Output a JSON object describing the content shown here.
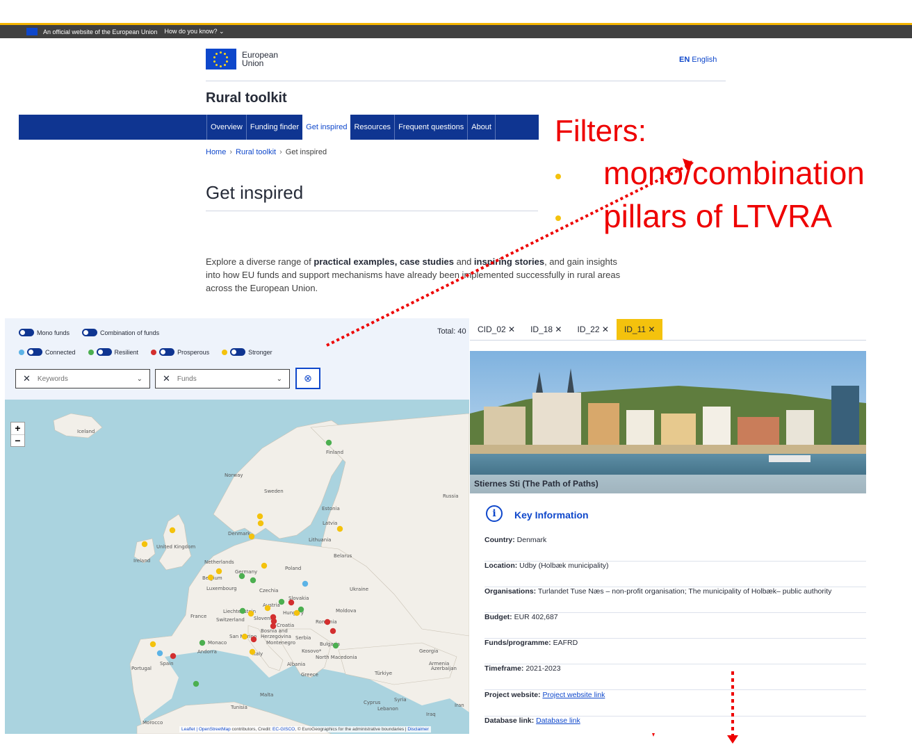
{
  "official_banner": {
    "text": "An official website of the European Union",
    "how": "How do you know? ⌄"
  },
  "header": {
    "logo_line1": "European",
    "logo_line2": "Union",
    "lang_code": "EN",
    "lang_name": "English",
    "site_title": "Rural toolkit"
  },
  "nav": {
    "items": [
      "Overview",
      "Funding finder",
      "Get inspired",
      "Resources",
      "Frequent questions",
      "About"
    ],
    "active": "Get inspired"
  },
  "breadcrumb": {
    "home": "Home",
    "toolkit": "Rural toolkit",
    "current": "Get inspired",
    "sep": "›"
  },
  "page": {
    "title": "Get inspired",
    "intro_1": "Explore a diverse range of ",
    "intro_b1": "practical examples, case studies",
    "intro_2": " and ",
    "intro_b2": "inspiring stories",
    "intro_3": ", and gain insights into how EU funds and support mechanisms have already been implemented successfully in rural areas across the European Union."
  },
  "annotation": {
    "title": "Filters:",
    "item1": "mono/combination",
    "item2": "pillars of LTVRA"
  },
  "map": {
    "toggle_mono": "Mono funds",
    "toggle_combination": "Combination of funds",
    "pillars": [
      {
        "label": "Connected",
        "color": "#5cb3e6"
      },
      {
        "label": "Resilient",
        "color": "#4caf50"
      },
      {
        "label": "Prosperous",
        "color": "#d32f2f"
      },
      {
        "label": "Stronger",
        "color": "#f4c20d"
      }
    ],
    "total": "Total: 40",
    "keywords_placeholder": "Keywords",
    "funds_placeholder": "Funds",
    "zoom_in": "+",
    "zoom_out": "−",
    "attribution_prefix": "Leaflet | ",
    "attribution_osm": "OpenStreetMap",
    "attribution_mid": " contributors, Credit: ",
    "attribution_ec": "EC-GISCO",
    "attribution_rest": ", © EuroGeographics for the administrative boundaries | ",
    "attribution_disclaimer": "Disclaimer"
  },
  "detail": {
    "tabs": [
      "CID_02 ✕",
      "ID_18 ✕",
      "ID_22 ✕",
      "ID_11 ✕"
    ],
    "active_tab": "ID_11 ✕",
    "project_title": "Stiernes Sti (The Path of Paths)",
    "key_info_title": "Key Information",
    "rows": [
      {
        "label": "Country:",
        "value": "Denmark"
      },
      {
        "label": "Location:",
        "value": "Udby  (Holbæk municipality)"
      },
      {
        "label": "Organisations:",
        "value": "Turlandet Tuse Næs – non-profit organisation; The municipality of Holbæk– public authority"
      },
      {
        "label": "Budget:",
        "value": "EUR 402,687"
      },
      {
        "label": "Funds/programme:",
        "value": "EAFRD"
      },
      {
        "label": "Timeframe:",
        "value": "2021-2023"
      }
    ],
    "website_label": "Project website:",
    "website_link": "Project website link",
    "database_label": "Database link:",
    "database_link": "Database link"
  }
}
